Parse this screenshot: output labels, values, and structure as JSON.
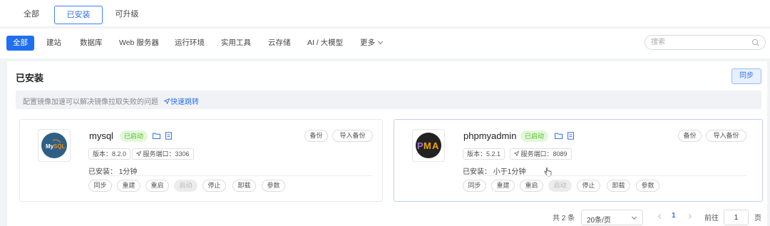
{
  "top_tabs": [
    "全部",
    "已安装",
    "可升级"
  ],
  "categories": [
    "全部",
    "建站",
    "数据库",
    "Web 服务器",
    "运行环境",
    "实用工具",
    "云存储",
    "AI / 大模型",
    "更多"
  ],
  "search": {
    "placeholder": "搜索"
  },
  "section": {
    "title": "已安装",
    "sync_label": "同步"
  },
  "notice": {
    "text": "配置镜像加速可以解决镜像拉取失败的问题",
    "link": "快速跳转"
  },
  "apps": [
    {
      "name": "mysql",
      "status": "已启动",
      "version_tag": "版本：8.2.0",
      "port_tag": "服务端口：3306",
      "installed": "已安装：  1分钟",
      "logo_text": "MySQL",
      "backup_label": "备份",
      "import_label": "导入备份",
      "actions": [
        "同步",
        "重建",
        "重启",
        "启动",
        "停止",
        "卸载",
        "参数"
      ]
    },
    {
      "name": "phpmyadmin",
      "status": "已启动",
      "version_tag": "版本：5.2.1",
      "port_tag": "服务端口：8089",
      "installed": "已安装：  小于1分钟",
      "logo_text": "PMA",
      "backup_label": "备份",
      "import_label": "导入备份",
      "actions": [
        "同步",
        "重建",
        "重启",
        "启动",
        "停止",
        "卸载",
        "参数"
      ]
    }
  ],
  "pagination": {
    "total": "共 2 条",
    "page_size": "20条/页",
    "current_page": "1",
    "goto_label": "前往",
    "goto_value": "1",
    "page_unit": "页"
  },
  "colors": {
    "accent": "#1f6ff0",
    "status_green": "#52c41a"
  }
}
